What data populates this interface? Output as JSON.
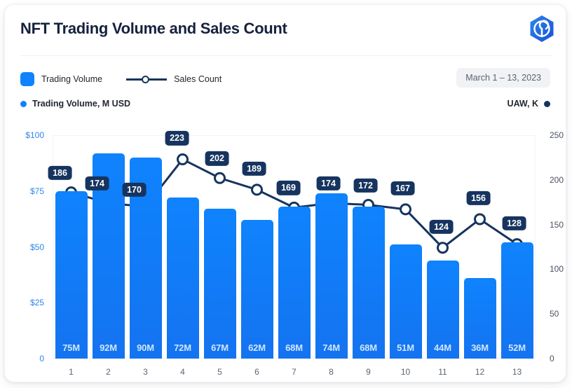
{
  "header": {
    "title": "NFT Trading Volume and Sales Count",
    "logo_icon": "hexagon-spiral-logo-icon",
    "date_range": "March 1 – 13, 2023"
  },
  "legend": {
    "items": [
      {
        "label": "Trading Volume",
        "marker": "square-swatch",
        "color": "#0f83fd"
      },
      {
        "label": "Sales Count",
        "marker": "line-with-circle",
        "color": "#16345f"
      }
    ]
  },
  "axis_captions": {
    "left": "Trading Volume, M USD",
    "right": "UAW, K"
  },
  "colors": {
    "bar": "#0f83fd",
    "line": "#16345f",
    "left_axis_text": "#2f86ec",
    "right_axis_text": "#4a5260",
    "label_pill_bg": "#16345f",
    "bar_value_text": "#cfe6ff"
  },
  "chart_data": {
    "type": "bar",
    "title": "NFT Trading Volume and Sales Count",
    "xlabel": "",
    "ylabel": "Trading Volume, M USD",
    "categories": [
      "1",
      "2",
      "3",
      "4",
      "5",
      "6",
      "7",
      "8",
      "9",
      "10",
      "11",
      "12",
      "13"
    ],
    "grid": false,
    "legend_position": "top-left",
    "series": [
      {
        "name": "Trading Volume",
        "type": "bar",
        "axis": "left",
        "unit": "M USD",
        "values": [
          75,
          92,
          90,
          72,
          67,
          62,
          68,
          74,
          68,
          51,
          44,
          36,
          52
        ],
        "labels": [
          "75M",
          "92M",
          "90M",
          "72M",
          "67M",
          "62M",
          "68M",
          "74M",
          "68M",
          "51M",
          "44M",
          "36M",
          "52M"
        ]
      },
      {
        "name": "Sales Count",
        "type": "line",
        "axis": "right",
        "unit": "K",
        "values": [
          186,
          174,
          170,
          223,
          202,
          189,
          169,
          174,
          172,
          167,
          124,
          156,
          128
        ],
        "labels": [
          "186",
          "174",
          "170",
          "223",
          "202",
          "189",
          "169",
          "174",
          "172",
          "167",
          "124",
          "156",
          "128"
        ]
      }
    ],
    "left_axis": {
      "ticks": [
        0,
        25,
        50,
        75,
        100
      ],
      "tick_labels": [
        "0",
        "$25",
        "$50",
        "$75",
        "$100"
      ],
      "ylim": [
        0,
        100
      ]
    },
    "right_axis": {
      "ticks": [
        0,
        50,
        100,
        150,
        200,
        250
      ],
      "tick_labels": [
        "0",
        "50",
        "100",
        "150",
        "200",
        "250"
      ],
      "ylim": [
        0,
        250
      ]
    },
    "x_tick_labels": [
      "1",
      "2",
      "3",
      "4",
      "5",
      "6",
      "7",
      "8",
      "9",
      "10",
      "11",
      "12",
      "13"
    ]
  }
}
